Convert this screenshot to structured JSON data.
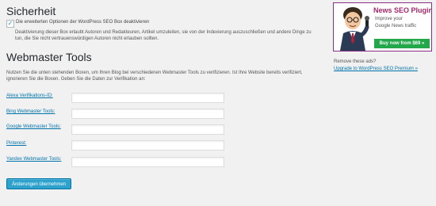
{
  "security": {
    "heading": "Sicherheit",
    "checkbox_checked": true,
    "checkbox_label": "Die erweiterten Optionen der WordPress SEO Box deaktivieren",
    "description": "Deaktivierung dieser Box erlaubt Autoren und Redakteuren, Artikel umzuleiten, sie von der Indexierung auszuschließen und andere Dinge zu tun, die Sie nicht vertrauenswürdigen Autoren nicht erlauben sollten."
  },
  "webmaster": {
    "heading": "Webmaster Tools",
    "intro": "Nutzen Sie die unten stehenden Boxen, um Ihren Blog bei verschiedenen Webmaster Tools zu verifizieren. Ist Ihre Website bereits verifiziert, ignorieren Sie die Boxen. Geben Sie die Daten zur Verifikation an:",
    "fields": [
      {
        "label": "Alexa Verifikations-ID",
        "value": ""
      },
      {
        "label": "Bing Webmaster Tools",
        "value": ""
      },
      {
        "label": "Google Webmaster Tools",
        "value": ""
      },
      {
        "label": "Pinterest",
        "value": ""
      },
      {
        "label": "Yandex Webmaster Tools",
        "value": ""
      }
    ],
    "colon": ":",
    "submit_label": "Änderungen übernehmen"
  },
  "ad": {
    "title": "News SEO Plugin",
    "line1": "Improve your",
    "line2": "Google News traffic",
    "buy_label": "Buy now from $69 »",
    "remove_text": "Remove these ads?",
    "upgrade_link": "Upgrade to WordPress SEO Premium »"
  },
  "colors": {
    "background": "#f1f1f1",
    "link": "#0073aa",
    "primary_button": "#2ea2cc",
    "ad_border": "#8a2f86",
    "ad_title": "#a4286a",
    "ad_buy": "#22a84b"
  }
}
